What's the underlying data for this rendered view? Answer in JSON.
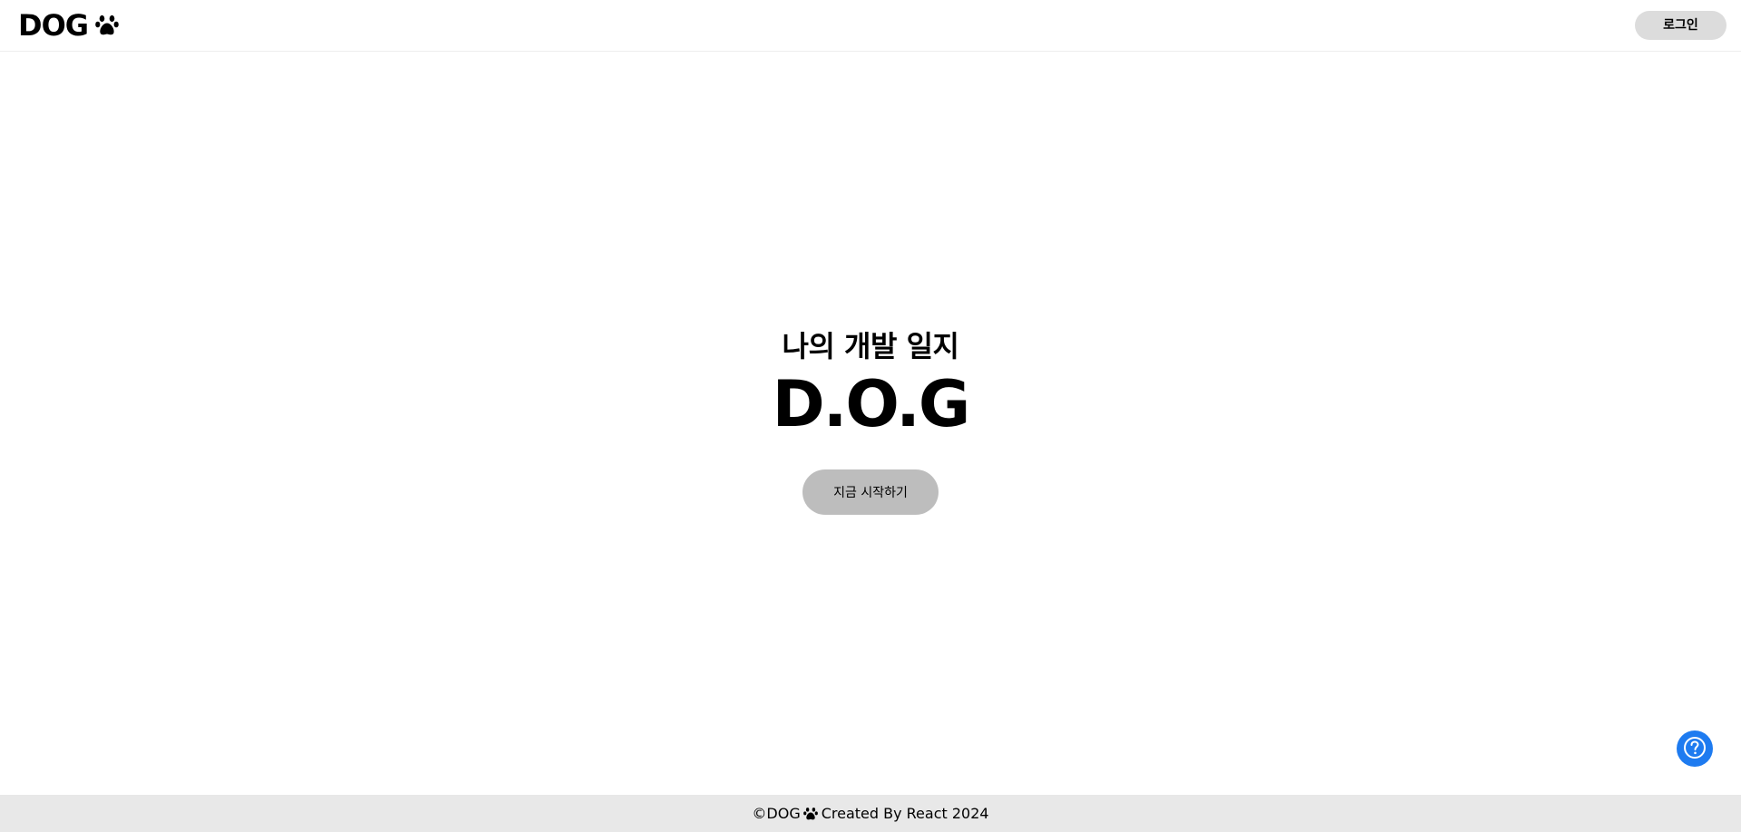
{
  "header": {
    "brand": "DOG",
    "brand_icon": "paw-icon",
    "login_label": "로그인"
  },
  "hero": {
    "subtitle": "나의 개발 일지",
    "title": "D.O.G",
    "start_label": "지금 시작하기"
  },
  "help": {
    "icon": "help-icon",
    "color": "#1e7bf0"
  },
  "footer": {
    "prefix": "©DOG",
    "icon": "paw-icon",
    "suffix": "Created By React 2024"
  }
}
